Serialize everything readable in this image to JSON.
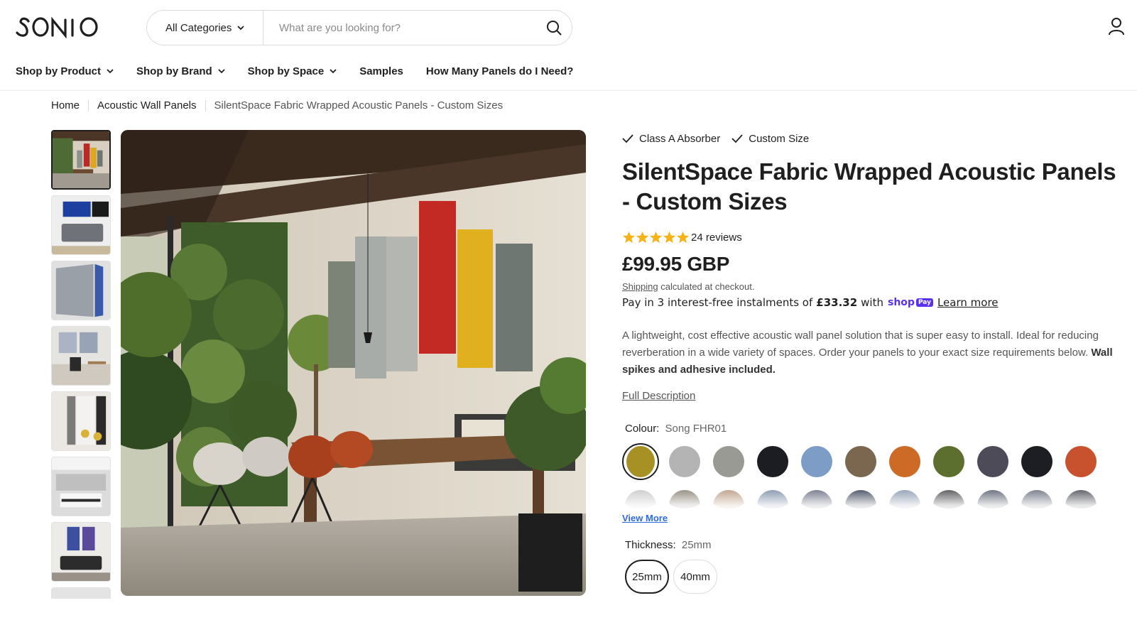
{
  "brand": {
    "name": "sonio"
  },
  "search": {
    "category_label": "All Categories",
    "placeholder": "What are you looking for?"
  },
  "nav": [
    {
      "label": "Shop by Product",
      "dropdown": true
    },
    {
      "label": "Shop by Brand",
      "dropdown": true
    },
    {
      "label": "Shop by Space",
      "dropdown": true
    },
    {
      "label": "Samples",
      "dropdown": false
    },
    {
      "label": "How Many Panels do I Need?",
      "dropdown": false
    }
  ],
  "breadcrumb": [
    "Home",
    "Acoustic Wall Panels",
    "SilentSpace Fabric Wrapped Acoustic Panels - Custom Sizes"
  ],
  "product": {
    "badges": [
      "Class A Absorber",
      "Custom Size"
    ],
    "title": "SilentSpace Fabric Wrapped Acoustic Panels - Custom Sizes",
    "rating": 5,
    "reviews": "24 reviews",
    "price": "£99.95 GBP",
    "shipping_link": "Shipping",
    "shipping_text": "calculated at checkout.",
    "instalments_prefix": "Pay in 3 interest-free instalments of",
    "instalments_amount": "£33.32",
    "instalments_suffix": "with",
    "shop_pay": "shop",
    "shop_pay_badge": "Pay",
    "learn_more": "Learn more",
    "description_plain": "A lightweight, cost effective acoustic wall panel solution that is super easy to install. Ideal for reducing reverberation in a wide variety of spaces. Order your panels to your exact size requirements below.",
    "description_bold": "Wall spikes and adhesive included.",
    "full_description": "Full Description",
    "colour_label": "Colour:",
    "colour_value": "Song FHR01",
    "colours": [
      "#a89124",
      "#b4b4b4",
      "#9a9a94",
      "#1c1d22",
      "#7e9dc6",
      "#7b6650",
      "#cc6a26",
      "#5d6f2e",
      "#4d4b57",
      "#1d1e23",
      "#c8522e"
    ],
    "colours_row2": [
      "#c8c8c8",
      "#8a8274",
      "#b89a80",
      "#7d8ea8",
      "#6a6f82",
      "#3c4658",
      "#8a9ab0",
      "#4a4a4e",
      "#5a6070",
      "#6a7080",
      "#4c5058"
    ],
    "view_more": "View More",
    "thickness_label": "Thickness:",
    "thickness_value": "25mm",
    "thickness_options": [
      "25mm",
      "40mm"
    ]
  }
}
